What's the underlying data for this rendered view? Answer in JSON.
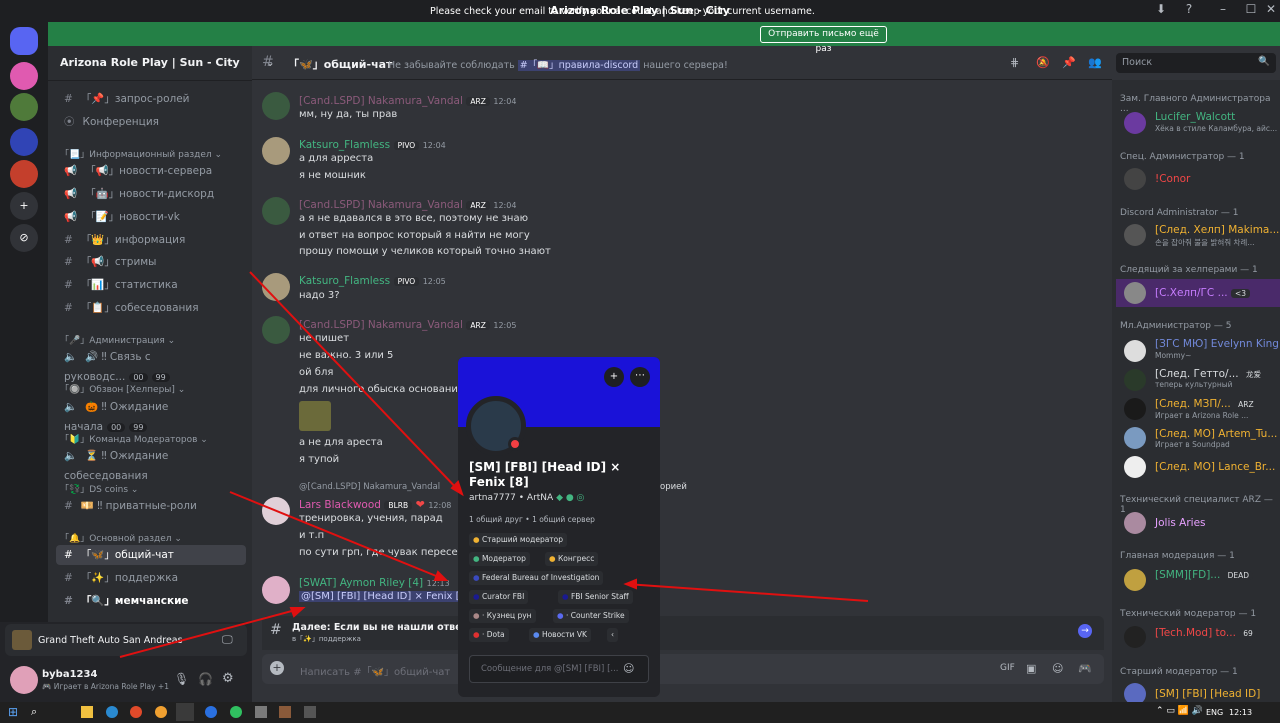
{
  "window": {
    "title": "Arizona Role Play | Sun - City",
    "minimize": "–",
    "maximize": "☐",
    "close": "✕"
  },
  "banner": {
    "text": "Please check your email to verify your account and keep your current username.",
    "button": "Отправить письмо ещё раз"
  },
  "server": {
    "name": "Arizona Role Play | Sun - City"
  },
  "channels": {
    "items": [
      {
        "label": "「📌」запрос-ролей"
      },
      {
        "label": "Конференция"
      }
    ],
    "cat_info": "「📃」Информационный раздел",
    "info_items": [
      {
        "label": "「📢」новости-сервера"
      },
      {
        "label": "「🤖」новости-дискорд"
      },
      {
        "label": "「📝」новости-vk"
      },
      {
        "label": "「👑」информация"
      },
      {
        "label": "「📢」стримы"
      },
      {
        "label": "「📊」статистика"
      },
      {
        "label": "「📋」собеседования"
      }
    ],
    "cat_admin": "「🎤」Администрация",
    "admin_voice": "🔊 ‼ Связь с руководс...",
    "admin_counts": [
      "00",
      "99"
    ],
    "cat_helpers": "「🔘」Обзвон [Хелперы]",
    "helpers_voice": "🎃 ‼ Ожидание начала",
    "helpers_counts": [
      "00",
      "99"
    ],
    "cat_mod": "「🔰」Команда Модераторов",
    "mod_voice": "⏳ ‼ Ожидание собеседования",
    "cat_ds": "「💱」DS coins",
    "ds_voice": "💴 ‼ приватные-роли",
    "cat_main": "「🔔」Основной раздел",
    "main_items": [
      {
        "label": "「🦋」общий-чат"
      },
      {
        "label": "「✨」поддержка"
      },
      {
        "label": "「🔍」мемчанские"
      }
    ]
  },
  "game_activity": "Grand Theft Auto San Andreas",
  "user": {
    "name": "byba1234",
    "status": "🎮 Играет в Arizona Role Play +1"
  },
  "header": {
    "channel": "「🦋」общий-чат",
    "topic_pre": "Не забывайте соблюдать",
    "topic_link": "「📖」правила-discord",
    "topic_post": "нашего сервера!",
    "search": "Поиск"
  },
  "messages": [
    {
      "author": "[Cand.LSPD] Nakamura_Vandal",
      "tag": "ARZ",
      "time": "12:04",
      "lines": [
        "мм, ну да, ты прав"
      ]
    },
    {
      "author": "Katsuro_Flamless",
      "tag": "PIVO",
      "time": "12:04",
      "lines": [
        "а для арреста",
        "я не мошник"
      ]
    },
    {
      "author": "[Cand.LSPD] Nakamura_Vandal",
      "tag": "ARZ",
      "time": "12:04",
      "lines": [
        "а я не вдавался в это все, поэтому не знаю",
        "и ответ на вопрос который я найти не могу",
        "прошу помощи у челиков который точно знают"
      ]
    },
    {
      "author": "Katsuro_Flamless",
      "tag": "PIVO",
      "time": "12:05",
      "lines": [
        "надо 3?"
      ]
    },
    {
      "author": "[Cand.LSPD] Nakamura_Vandal",
      "tag": "ARZ",
      "time": "12:05",
      "lines": [
        "не пишет",
        "не важно. 3 или 5",
        "ой бля",
        "для личного обыска основания"
      ]
    },
    {
      "lines": [
        "а не для ареста",
        "я тупой"
      ]
    },
    {
      "reply": "@[Cand.LSPD] Nakamura_Vandal",
      "reply_tail": "орией",
      "author": "Lars Blackwood",
      "tag": "BLRB",
      "time": "12:08",
      "lines": [
        "тренировка, учения, парад",
        "и т.п",
        "по сути грп, где чувак пересекает"
      ]
    },
    {
      "author": "[SWAT] Aymon Riley [4]",
      "time": "12:13",
      "lines": [
        "@[SM] [FBI] [Head ID] × Fenix [8]"
      ]
    }
  ],
  "notice": {
    "title": "Далее: Если вы не нашли ответ на",
    "sub": "в「✨」поддержка"
  },
  "composer": {
    "placeholder": "Написать #「🦋」общий-чат"
  },
  "popup": {
    "name": "[SM] [FBI] [Head ID] × Fenix [8]",
    "handle": "artna7777",
    "nick": "ArtNA",
    "mutual": "1 общий друг • 1 общий сервер",
    "roles": [
      "Старший модератор",
      "Модератор",
      "Конгресс",
      "Federal Bureau of Investigation",
      "Curator FBI",
      "FBI Senior Staff",
      "· Кузнец рун",
      "· Counter Strike",
      "· Dota",
      "Новости VK"
    ],
    "message_placeholder": "Сообщение для @[SM] [FBI] [...",
    "more": "‹"
  },
  "members": [
    {
      "cat": "Зам. Главного Администратора ...",
      "name": "Lucifer_Walcott",
      "sub": "Хёка в стиле Каламбура, айс...",
      "color": "#43b581"
    },
    {
      "cat": "Спец. Администратор — 1",
      "name": "!Conor",
      "sub": "",
      "color": "#f04747"
    },
    {
      "cat": "Discord Administrator — 1",
      "name": "[След. Хелп] Makima...",
      "sub": "손을 잡아줘 불을 밝혀줘 차례...",
      "color": "#f0b232"
    },
    {
      "cat": "Следящий за хелперами — 1",
      "name": "[C.Хелп/ГС ...",
      "sub": "",
      "badge": "<3",
      "color": "#c77dff"
    },
    {
      "cat": "Мл.Администратор — 5",
      "name": "[ЗГС МЮ] Evelynn King",
      "sub": "Mommy~",
      "color": "#7289da"
    },
    {
      "name": "[След. Гетто/...",
      "sub": "теперь культурный",
      "badge": "龙爱",
      "color": "#dbdee1"
    },
    {
      "name": "[След. МЗП/...",
      "sub": "Играет в Arizona Role ...",
      "badge": "ARZ",
      "color": "#f0b232"
    },
    {
      "name": "[След. МО] Artem_Tu...",
      "sub": "Играет в Soundpad",
      "color": "#f0b232"
    },
    {
      "name": "[След. МО] Lance_Br...",
      "sub": "",
      "color": "#f0b232"
    },
    {
      "cat": "Технический специалист ARZ — 1",
      "name": "Jolis Aries",
      "sub": "",
      "color": "#e7a1ff"
    },
    {
      "cat": "Главная модерация — 1",
      "name": "[SMM][FD]...",
      "sub": "",
      "badge": "DEAD",
      "color": "#43b581"
    },
    {
      "cat": "Технический модератор — 1",
      "name": "[Tech.Mod] to...",
      "sub": "",
      "badge": "69",
      "color": "#f04747"
    },
    {
      "cat": "Старший модератор — 1",
      "name": "[SM] [FBI] [Head ID] ×...",
      "sub": "",
      "color": "#f0b232"
    }
  ],
  "taskbar": {
    "lang": "ENG",
    "time": "12:13"
  }
}
